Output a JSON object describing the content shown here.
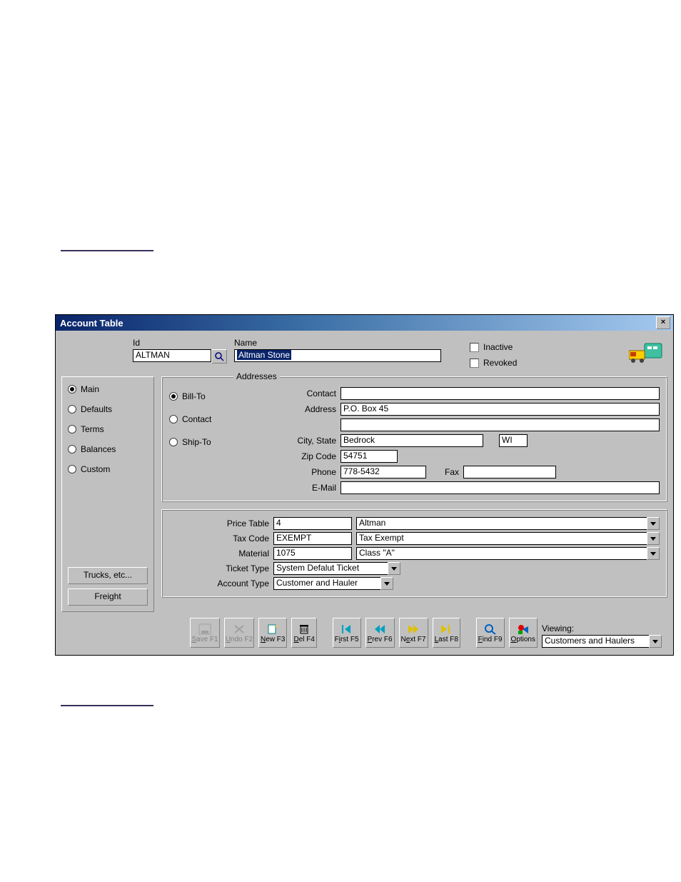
{
  "window": {
    "title": "Account Table",
    "close": "×"
  },
  "header": {
    "id_label": "Id",
    "id_value": "ALTMAN",
    "name_label": "Name",
    "name_value": "Altman Stone",
    "inactive_label": "Inactive",
    "revoked_label": "Revoked"
  },
  "side": {
    "radios": [
      "Main",
      "Defaults",
      "Terms",
      "Balances",
      "Custom"
    ],
    "selected": 0,
    "trucks_btn": "Trucks, etc...",
    "freight_btn": "Freight"
  },
  "addresses": {
    "legend": "Addresses",
    "types": [
      "Bill-To",
      "Contact",
      "Ship-To"
    ],
    "type_selected": 0,
    "contact_label": "Contact",
    "contact_value": "",
    "address_label": "Address",
    "address1": "P.O. Box 45",
    "address2": "",
    "citystate_label": "City, State",
    "city": "Bedrock",
    "state": "WI",
    "zip_label": "Zip Code",
    "zip": "54751",
    "phone_label": "Phone",
    "phone": "778-5432",
    "fax_label": "Fax",
    "fax": "",
    "email_label": "E-Mail",
    "email": ""
  },
  "details": {
    "price_table_label": "Price Table",
    "price_table_code": "4",
    "price_table_name": "Altman",
    "tax_code_label": "Tax Code",
    "tax_code": "EXEMPT",
    "tax_code_name": "Tax Exempt",
    "material_label": "Material",
    "material_code": "1075",
    "material_name": "Class  \"A\"",
    "ticket_type_label": "Ticket Type",
    "ticket_type": "System Defalut Ticket",
    "account_type_label": "Account Type",
    "account_type": "Customer and Hauler"
  },
  "toolbar": {
    "save": "Save F1",
    "undo": "Undo F2",
    "new": "New F3",
    "del": "Del F4",
    "first": "First F5",
    "prev": "Prev F6",
    "next": "Next F7",
    "last": "Last F8",
    "find": "Find F9",
    "options": "Options"
  },
  "viewing": {
    "label": "Viewing:",
    "value": "Customers and Haulers"
  }
}
